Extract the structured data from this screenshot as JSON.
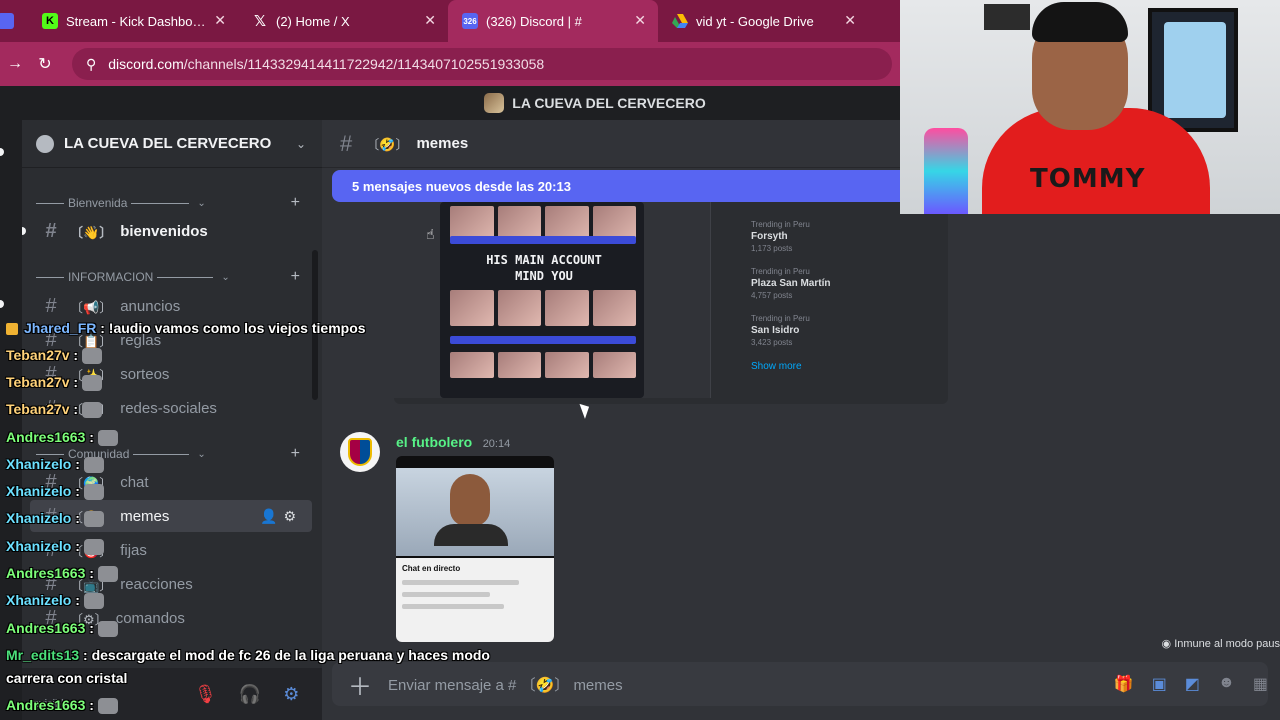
{
  "browser": {
    "tabs": [
      {
        "label": "Stream - Kick Dashboard",
        "icon": "kick-icon",
        "active": false
      },
      {
        "label": "(2) Home / X",
        "icon": "x-icon",
        "active": false
      },
      {
        "label": "(326) Discord | #",
        "icon": "discord-icon",
        "active": true
      },
      {
        "label": "vid yt - Google Drive",
        "icon": "drive-icon",
        "active": false
      }
    ],
    "url_host": "discord.com",
    "url_path": "/channels/1143329414411722942/1143407102551933058",
    "accent": "#a32a5e"
  },
  "discord": {
    "window_title": "LA CUEVA DEL CERVECERO",
    "server_name": "LA CUEVA DEL CERVECERO",
    "categories": [
      {
        "label": "Bienvenida"
      },
      {
        "label": "INFORMACION"
      },
      {
        "label": "Comunidad"
      }
    ],
    "channels": [
      {
        "name": "bienvenidos",
        "emoji": "👋"
      },
      {
        "name": "anuncios",
        "emoji": "📢"
      },
      {
        "name": "reglas",
        "emoji": "📋"
      },
      {
        "name": "sorteos",
        "emoji": "✨"
      },
      {
        "name": "redes-sociales",
        "emoji": "🌐"
      },
      {
        "name": "chat",
        "emoji": "🌍"
      },
      {
        "name": "memes",
        "emoji": "🤣"
      },
      {
        "name": "fijas",
        "emoji": "🎯"
      },
      {
        "name": "reacciones",
        "emoji": "📺"
      },
      {
        "name": "comandos",
        "emoji": "⚙"
      }
    ],
    "user_status": "Invisible",
    "channel_header": "memes",
    "channel_header_emoji": "🤣",
    "new_messages_banner": "5 mensajes nuevos desde las 20:13",
    "image1_caption": "HIS MAIN ACCOUNT MIND YOU",
    "trending": [
      {
        "kicker": "Trending in Peru",
        "topic": "Forsyth",
        "count": "1,173 posts"
      },
      {
        "kicker": "Trending in Peru",
        "topic": "Plaza San Martín",
        "count": "4,757 posts"
      },
      {
        "kicker": "Trending in Peru",
        "topic": "San Isidro",
        "count": "3,423 posts"
      }
    ],
    "trending_more": "Show more",
    "message": {
      "author": "el futbolero",
      "time": "20:14"
    },
    "image2_panel_title": "Chat en directo",
    "composer_placeholder": "Enviar mensaje a #",
    "composer_channel": "memes",
    "immune_text": "Inmune al modo paus"
  },
  "stream_chat": [
    {
      "user": "Jhared_FR",
      "text": ": !audio vamos como los viejos tiempos",
      "color": "#7cb7ff",
      "badge": true,
      "emote": false
    },
    {
      "user": "Teban27v",
      "text": ":",
      "color": "#ffd27a",
      "badge": false,
      "emote": true
    },
    {
      "user": "Teban27v",
      "text": ":",
      "color": "#ffd27a",
      "badge": false,
      "emote": true
    },
    {
      "user": "Teban27v",
      "text": ":",
      "color": "#ffd27a",
      "badge": false,
      "emote": true
    },
    {
      "user": "Andres1663",
      "text": ":",
      "color": "#7dff7a",
      "badge": false,
      "emote": true
    },
    {
      "user": "Xhanizelo",
      "text": ":",
      "color": "#6ce0ff",
      "badge": false,
      "emote": true
    },
    {
      "user": "Xhanizelo",
      "text": ":",
      "color": "#6ce0ff",
      "badge": false,
      "emote": true
    },
    {
      "user": "Xhanizelo",
      "text": ":",
      "color": "#6ce0ff",
      "badge": false,
      "emote": true
    },
    {
      "user": "Xhanizelo",
      "text": ":",
      "color": "#6ce0ff",
      "badge": false,
      "emote": true
    },
    {
      "user": "Andres1663",
      "text": ":",
      "color": "#7dff7a",
      "badge": false,
      "emote": true
    },
    {
      "user": "Xhanizelo",
      "text": ":",
      "color": "#6ce0ff",
      "badge": false,
      "emote": true
    },
    {
      "user": "Andres1663",
      "text": ":",
      "color": "#7dff7a",
      "badge": false,
      "emote": true
    },
    {
      "user": "Mr_edits13",
      "text": ": descargate el mod de fc 26 de la liga peruana y haces modo",
      "color": "#4be07a",
      "badge": false,
      "emote": false
    },
    {
      "user": "",
      "text": "carrera con cristal",
      "color": "#ffffff",
      "badge": false,
      "emote": false
    },
    {
      "user": "Andres1663",
      "text": ":",
      "color": "#7dff7a",
      "badge": false,
      "emote": true
    }
  ],
  "webcam": {
    "shirt_brand": "TOMMY"
  }
}
